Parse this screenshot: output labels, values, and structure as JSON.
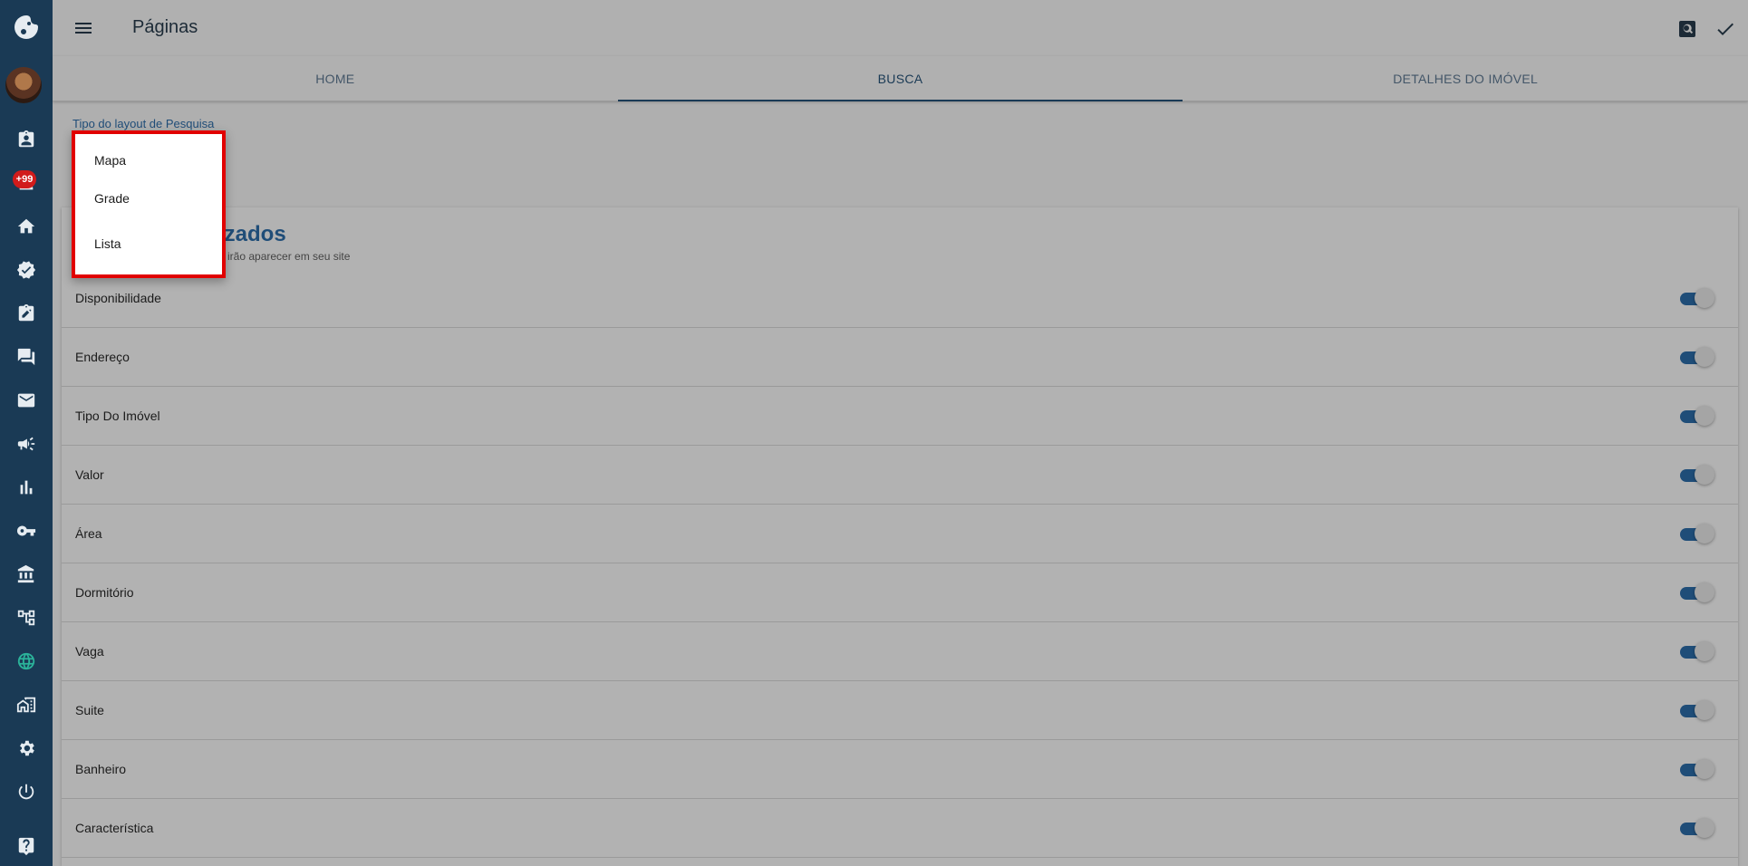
{
  "header": {
    "title": "Páginas"
  },
  "rail": {
    "badge": "+99"
  },
  "tabs": [
    {
      "label": "HOME"
    },
    {
      "label": "BUSCA"
    },
    {
      "label": "DETALHES DO IMÓVEL"
    }
  ],
  "search_layout": {
    "label": "Tipo do layout de Pesquisa",
    "options": [
      "Mapa",
      "Grade",
      "Lista"
    ]
  },
  "filters_card": {
    "title_visible": "izados",
    "subtitle_visible": "irão aparecer em seu site",
    "items": [
      {
        "label": "Disponibilidade",
        "enabled": true
      },
      {
        "label": "Endereço",
        "enabled": true
      },
      {
        "label": "Tipo Do Imóvel",
        "enabled": true
      },
      {
        "label": "Valor",
        "enabled": true
      },
      {
        "label": "Área",
        "enabled": true
      },
      {
        "label": "Dormitório",
        "enabled": true
      },
      {
        "label": "Vaga",
        "enabled": true
      },
      {
        "label": "Suite",
        "enabled": true
      },
      {
        "label": "Banheiro",
        "enabled": true
      },
      {
        "label": "Característica",
        "enabled": true
      }
    ]
  },
  "colors": {
    "rail": "#1a3a55",
    "accent": "#1f4d78",
    "highlight": "#e10000",
    "badge": "#d11b1b",
    "active_icon": "#2bb39a"
  }
}
